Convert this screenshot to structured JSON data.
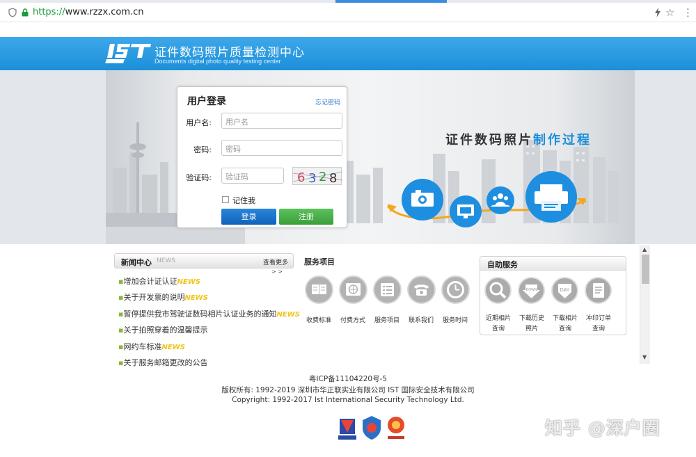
{
  "browser": {
    "url_proto": "https://",
    "url_rest": "www.rzzx.com.cn"
  },
  "header": {
    "logo_text": "IST",
    "title": "证件数码照片质量检测中心",
    "subtitle": "Documents digital photo quality testing center"
  },
  "banner": {
    "process_title_a": "证件数码照片",
    "process_title_b": "制作过程"
  },
  "login": {
    "title": "用户登录",
    "forgot": "忘记密码",
    "username_label": "用户名:",
    "username_placeholder": "用户名",
    "password_label": "密码:",
    "password_placeholder": "密码",
    "captcha_label": "验证码:",
    "captcha_placeholder": "验证码",
    "captcha_digits": [
      "6",
      "3",
      "2",
      "8"
    ],
    "remember": "记住我",
    "login_button": "登录",
    "register_button": "注册"
  },
  "news": {
    "title": "新闻中心",
    "tag": "NEWS",
    "more": "查看更多",
    "arrows": "> >",
    "badge": "NEWS",
    "items": [
      {
        "text": "增加会计证认证",
        "new": true
      },
      {
        "text": "关于开发票的说明",
        "new": true
      },
      {
        "text": "暂停提供我市驾驶证数码相片认证业务的通知",
        "new": true
      },
      {
        "text": "关于拍照穿着的温馨提示",
        "new": false
      },
      {
        "text": "网约车标准",
        "new": true
      },
      {
        "text": "关于服务邮箱更改的公告",
        "new": false
      }
    ]
  },
  "services": {
    "title": "服务项目",
    "items": [
      {
        "label": "收费标准",
        "icon": "book-icon"
      },
      {
        "label": "付费方式",
        "icon": "globe-icon"
      },
      {
        "label": "服务项目",
        "icon": "list-icon"
      },
      {
        "label": "联系我们",
        "icon": "phone-icon"
      },
      {
        "label": "服务时间",
        "icon": "clock-icon"
      }
    ]
  },
  "self_service": {
    "title": "自助服务",
    "items": [
      {
        "line1": "近期相片",
        "line2": "查询",
        "icon": "magnifier-icon"
      },
      {
        "line1": "下载历史",
        "line2": "照片",
        "icon": "download-icon"
      },
      {
        "line1": "下载相片",
        "line2": "查询",
        "icon": "day-icon"
      },
      {
        "line1": "冲印订单",
        "line2": "查询",
        "icon": "document-icon"
      }
    ],
    "download_badge": "DOWN",
    "day_badge": "DAY"
  },
  "footer": {
    "icp": "粤ICP备11104220号-5",
    "copyright_cn": "版权所有: 1992-2019 深圳市华正联实业有限公司 IST 国际安全技术有限公司",
    "copyright_en": "Copyright: 1992-2017 Ist International Security Technology Ltd."
  },
  "watermark": "知乎 @深户圈",
  "colors": {
    "header_blue": "#1b8fd9",
    "login_blue": "#1567c0",
    "register_green": "#46a946",
    "news_badge_yellow": "#f0c418",
    "url_green": "#1a9c3b"
  }
}
